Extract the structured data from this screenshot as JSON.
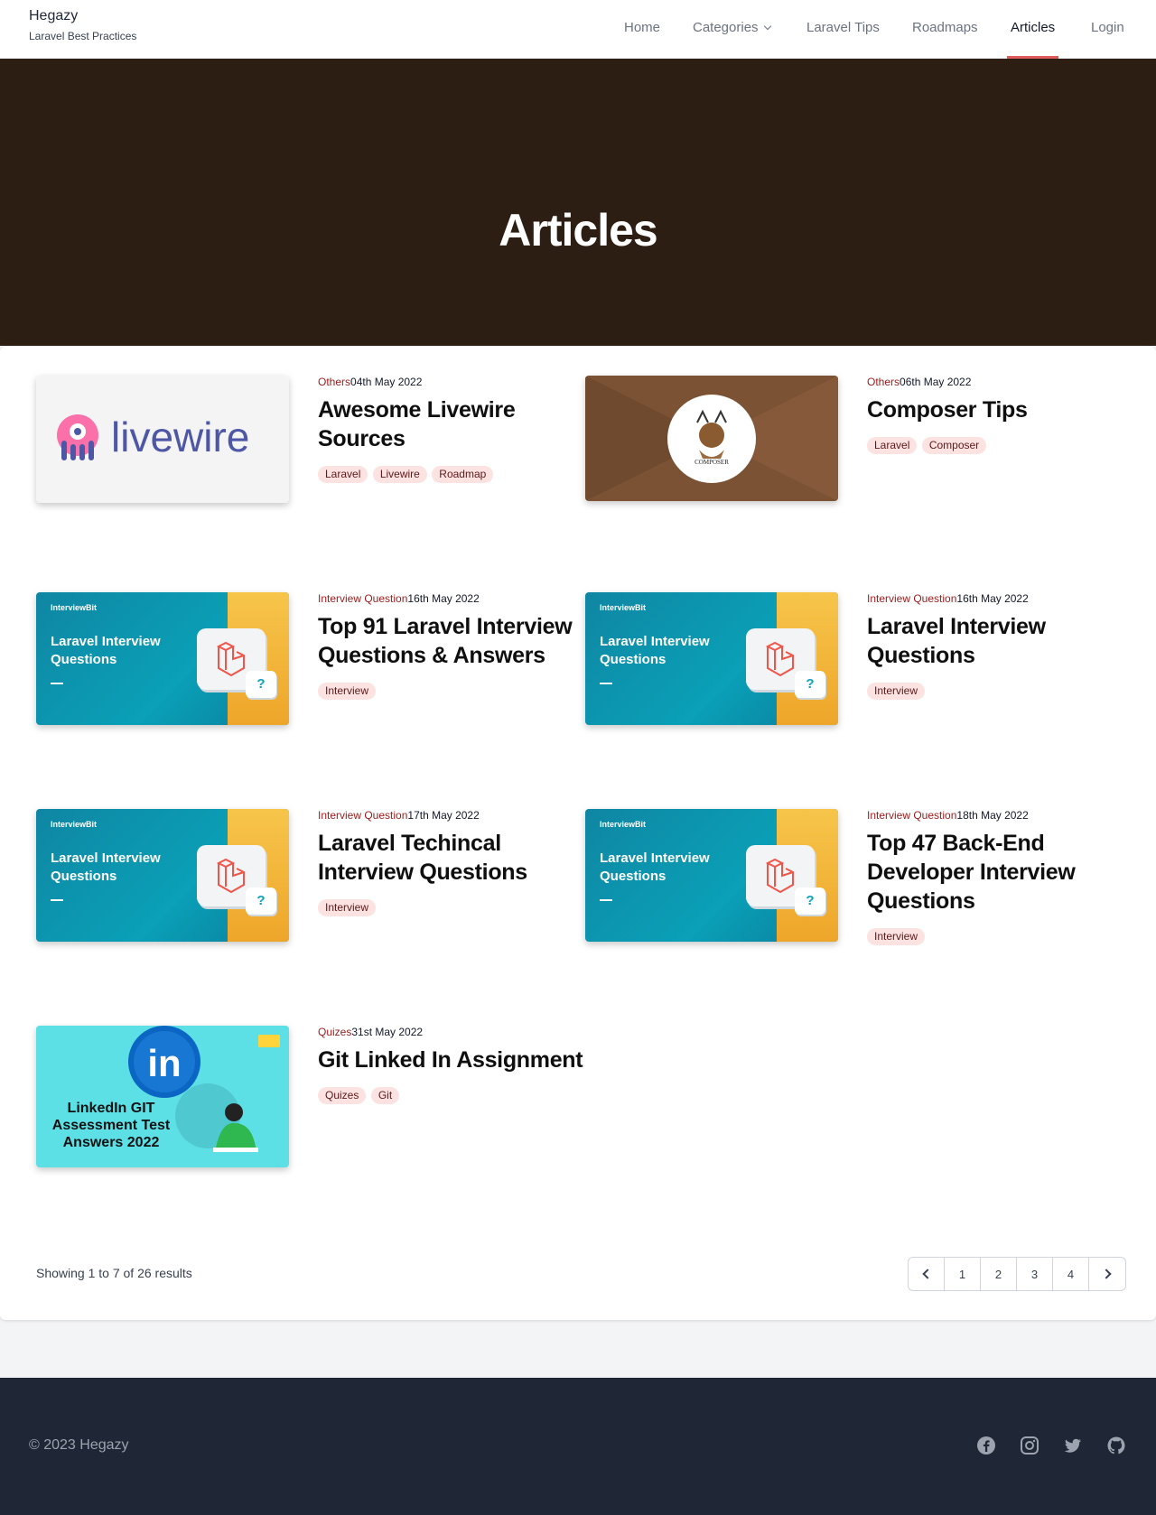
{
  "brand": {
    "name": "Hegazy",
    "tagline": "Laravel Best Practices"
  },
  "nav": {
    "home": "Home",
    "categories": "Categories",
    "laravel_tips": "Laravel Tips",
    "roadmaps": "Roadmaps",
    "articles": "Articles",
    "login": "Login",
    "active": "Articles",
    "accent_color": "#e05a5a"
  },
  "hero": {
    "title": "Articles",
    "background": "#2d1e14"
  },
  "articles": [
    {
      "category": "Others",
      "date": "04th May 2022",
      "title": "Awesome Livewire Sources",
      "tags": [
        "Laravel",
        "Livewire",
        "Roadmap"
      ],
      "thumbnail": "livewire-logo",
      "thumb_text": "livewire"
    },
    {
      "category": "Others",
      "date": "06th May 2022",
      "title": "Composer Tips",
      "tags": [
        "Laravel",
        "Composer"
      ],
      "thumbnail": "composer-logo",
      "thumb_text": "COMPOSER"
    },
    {
      "category": "Interview Question",
      "date": "16th May 2022",
      "title": "Top 91 Laravel Interview Questions & Answers",
      "tags": [
        "Interview"
      ],
      "thumbnail": "interviewbit-banner",
      "thumb_brand": "InterviewBit",
      "thumb_text": "Laravel Interview Questions"
    },
    {
      "category": "Interview Question",
      "date": "16th May 2022",
      "title": "Laravel Interview Questions",
      "tags": [
        "Interview"
      ],
      "thumbnail": "interviewbit-banner",
      "thumb_brand": "InterviewBit",
      "thumb_text": "Laravel Interview Questions"
    },
    {
      "category": "Interview Question",
      "date": "17th May 2022",
      "title": "Laravel Techincal Interview Questions",
      "tags": [
        "Interview"
      ],
      "thumbnail": "interviewbit-banner",
      "thumb_brand": "InterviewBit",
      "thumb_text": "Laravel Interview Questions"
    },
    {
      "category": "Interview Question",
      "date": "18th May 2022",
      "title": "Top 47 Back-End Developer Interview Questions",
      "tags": [
        "Interview"
      ],
      "thumbnail": "interviewbit-banner",
      "thumb_brand": "InterviewBit",
      "thumb_text": "Laravel Interview Questions"
    },
    {
      "category": "Quizes",
      "date": "31st May 2022",
      "title": "Git Linked In Assignment",
      "tags": [
        "Quizes",
        "Git"
      ],
      "thumbnail": "linkedin-banner",
      "thumb_text": "LinkedIn GIT Assessment Test Answers 2022",
      "thumb_logo": "in"
    }
  ],
  "pagination": {
    "summary": "Showing 1 to 7 of 26 results",
    "pages": [
      "1",
      "2",
      "3",
      "4"
    ],
    "prev_icon": "chevron-left-icon",
    "next_icon": "chevron-right-icon"
  },
  "footer": {
    "copyright": "© 2023 Hegazy",
    "social_icons": [
      "facebook-icon",
      "instagram-icon",
      "twitter-icon",
      "github-icon"
    ],
    "background": "#1f2736"
  }
}
